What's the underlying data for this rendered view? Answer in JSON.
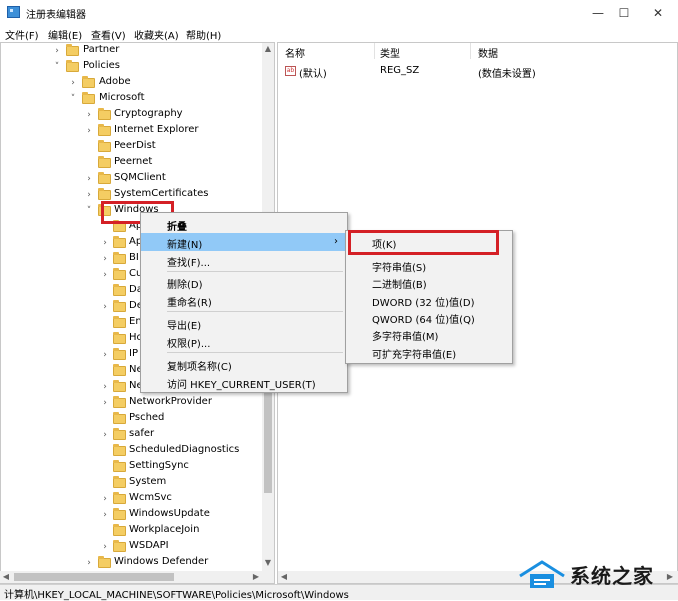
{
  "window": {
    "title": "注册表编辑器",
    "minimize": "—",
    "maximize": "☐",
    "close": "✕"
  },
  "menu": [
    "文件(F)",
    "编辑(E)",
    "查看(V)",
    "收藏夹(A)",
    "帮助(H)"
  ],
  "tree": [
    {
      "label": "Partner",
      "exp": "›"
    },
    {
      "label": "Policies",
      "exp": "˅"
    },
    {
      "label": "Adobe",
      "exp": "›"
    },
    {
      "label": "Microsoft",
      "exp": "˅"
    },
    {
      "label": "Cryptography",
      "exp": "›"
    },
    {
      "label": "Internet Explorer",
      "exp": "›"
    },
    {
      "label": "PeerDist",
      "exp": ""
    },
    {
      "label": "Peernet",
      "exp": ""
    },
    {
      "label": "SQMClient",
      "exp": "›"
    },
    {
      "label": "SystemCertificates",
      "exp": "›"
    },
    {
      "label": "Windows",
      "exp": "˅"
    },
    {
      "label": "Ap",
      "exp": ""
    },
    {
      "label": "Ap",
      "exp": "›"
    },
    {
      "label": "BI",
      "exp": "›"
    },
    {
      "label": "Cu",
      "exp": "›"
    },
    {
      "label": "Da",
      "exp": ""
    },
    {
      "label": "De",
      "exp": "›"
    },
    {
      "label": "En",
      "exp": ""
    },
    {
      "label": "Ho",
      "exp": ""
    },
    {
      "label": "IP",
      "exp": "›"
    },
    {
      "label": "Ne",
      "exp": ""
    },
    {
      "label": "Ne",
      "exp": "›"
    },
    {
      "label": "NetworkProvider",
      "exp": "›"
    },
    {
      "label": "Psched",
      "exp": ""
    },
    {
      "label": "safer",
      "exp": "›"
    },
    {
      "label": "ScheduledDiagnostics",
      "exp": ""
    },
    {
      "label": "SettingSync",
      "exp": ""
    },
    {
      "label": "System",
      "exp": ""
    },
    {
      "label": "WcmSvc",
      "exp": "›"
    },
    {
      "label": "WindowsUpdate",
      "exp": "›"
    },
    {
      "label": "WorkplaceJoin",
      "exp": ""
    },
    {
      "label": "WSDAPI",
      "exp": "›"
    },
    {
      "label": "Windows Defender",
      "exp": "›"
    }
  ],
  "values_pane": {
    "headers": [
      "名称",
      "类型",
      "数据"
    ],
    "rows": [
      {
        "name": "(默认)",
        "type": "REG_SZ",
        "data": "(数值未设置)",
        "icon": "ab"
      }
    ]
  },
  "context_menu": {
    "items": [
      "折叠",
      "新建(N)",
      "查找(F)...",
      "删除(D)",
      "重命名(R)",
      "导出(E)",
      "权限(P)...",
      "复制项名称(C)",
      "访问 HKEY_CURRENT_USER(T)"
    ],
    "arrow": "›"
  },
  "submenu": {
    "items": [
      "项(K)",
      "字符串值(S)",
      "二进制值(B)",
      "DWORD (32 位)值(D)",
      "QWORD (64 位)值(Q)",
      "多字符串值(M)",
      "可扩充字符串值(E)"
    ]
  },
  "status": "计算机\\HKEY_LOCAL_MACHINE\\SOFTWARE\\Policies\\Microsoft\\Windows",
  "watermark": "系统之家",
  "colors": {
    "highlight": "#91c9f7",
    "annotation": "#d42026",
    "folder": "#f4cd63"
  }
}
